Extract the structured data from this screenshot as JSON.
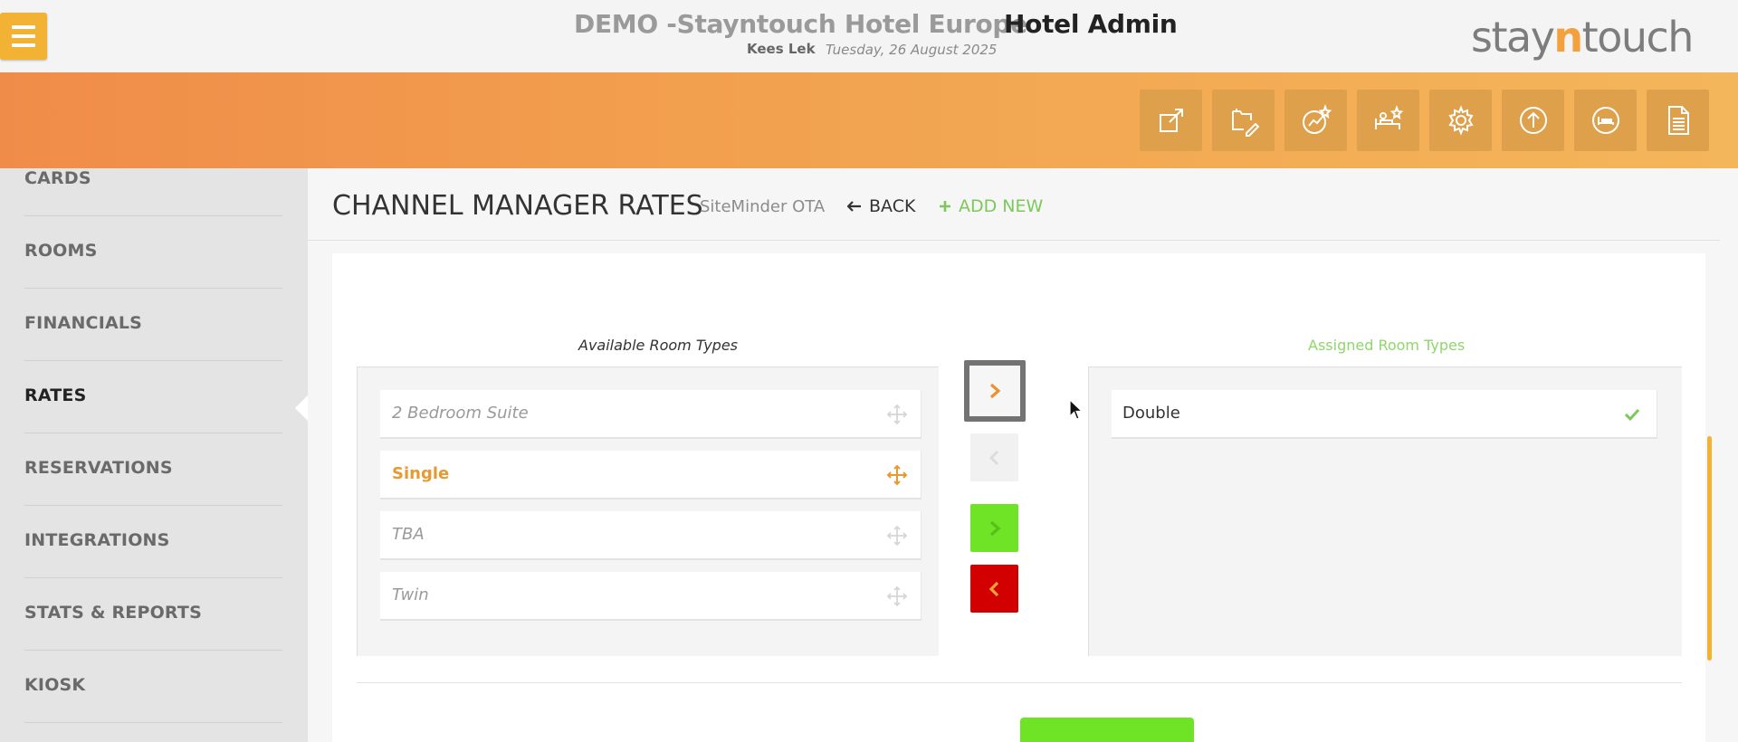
{
  "header": {
    "hotel_name": "DEMO -Stayntouch Hotel Europe",
    "title": "Hotel Admin",
    "user": "Kees Lek",
    "date": "Tuesday, 26 August 2025",
    "logo_pre": "stay",
    "logo_n": "n",
    "logo_post": "touch"
  },
  "toolbar": {
    "icons": [
      "external-link-icon",
      "folder-edit-icon",
      "stats-star-icon",
      "room-service-icon",
      "gear-icon",
      "upload-icon",
      "bed-icon",
      "document-icon"
    ]
  },
  "sidebar": {
    "items": [
      {
        "label": "CARDS"
      },
      {
        "label": "ROOMS"
      },
      {
        "label": "FINANCIALS"
      },
      {
        "label": "RATES"
      },
      {
        "label": "RESERVATIONS"
      },
      {
        "label": "INTEGRATIONS"
      },
      {
        "label": "STATS & REPORTS"
      },
      {
        "label": "KIOSK"
      }
    ],
    "active": "RATES"
  },
  "page": {
    "title": "CHANNEL MANAGER RATES",
    "subtitle": "SiteMinder OTA",
    "back_label": "BACK",
    "add_new_label": "ADD NEW"
  },
  "room_types": {
    "available_label": "Available Room Types",
    "assigned_label": "Assigned Room Types",
    "available": [
      {
        "label": "2 Bedroom Suite",
        "selected": false
      },
      {
        "label": "Single",
        "selected": true
      },
      {
        "label": "TBA",
        "selected": false
      },
      {
        "label": "Twin",
        "selected": false
      }
    ],
    "assigned": [
      {
        "label": "Double"
      }
    ]
  },
  "colors": {
    "accent_orange": "#f2b233",
    "selected_text": "#e89a32",
    "green": "#6fe426",
    "red": "#d20000",
    "assigned_label": "#8fd66b"
  }
}
